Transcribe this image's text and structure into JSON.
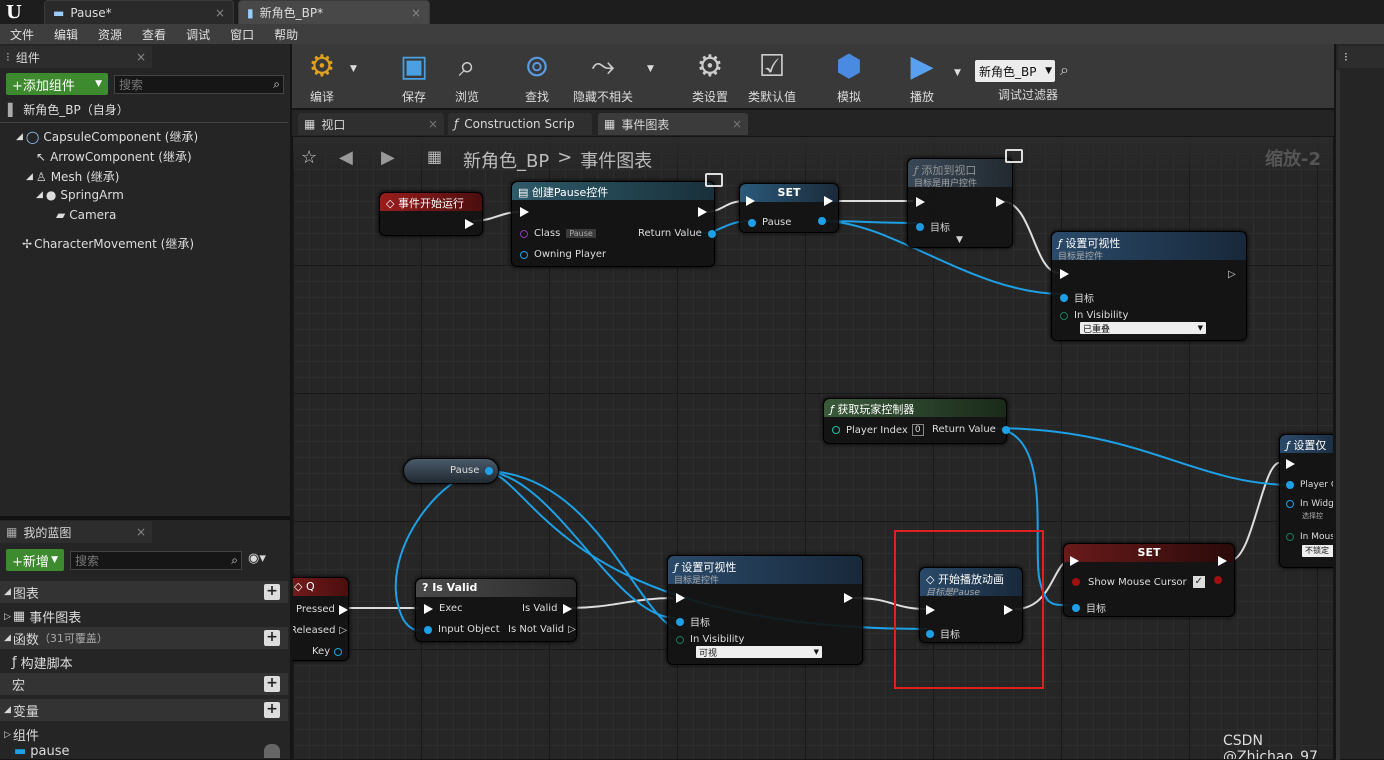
{
  "title_tabs": [
    {
      "label": "Pause*"
    },
    {
      "label": "新角色_BP*"
    }
  ],
  "menu": [
    "文件",
    "编辑",
    "资源",
    "查看",
    "调试",
    "窗口",
    "帮助"
  ],
  "components_panel": {
    "title": "组件",
    "add_button": "+添加组件",
    "search_placeholder": "搜索",
    "self": "新角色_BP（自身）",
    "tree": [
      "CapsuleComponent (继承)",
      "ArrowComponent (继承)",
      "Mesh (继承)",
      "SpringArm",
      "Camera",
      "CharacterMovement (继承)"
    ]
  },
  "blueprint_panel": {
    "title": "我的蓝图",
    "new_button": "+新增",
    "search_placeholder": "搜索",
    "sections": {
      "graphs": "图表",
      "event_graph": "事件图表",
      "functions": "函数",
      "functions_note": "（31可覆盖）",
      "construct": "构建脚本",
      "macros": "宏",
      "variables": "变量",
      "components": "组件",
      "pause": "pause"
    }
  },
  "toolbar": {
    "compile": "编译",
    "save": "保存",
    "browse": "浏览",
    "find": "查找",
    "hide_unrelated": "隐藏不相关",
    "class_settings": "类设置",
    "class_defaults": "类默认值",
    "simulate": "模拟",
    "play": "播放",
    "debug_target": "新角色_BP",
    "debug_filter": "调试过滤器"
  },
  "graph_tabs": [
    "视口",
    "Construction Scrip",
    "事件图表"
  ],
  "breadcrumb": {
    "root": "新角色_BP",
    "sep": ">",
    "current": "事件图表",
    "zoom": "缩放-2"
  },
  "nodes": {
    "begin_play": {
      "title": "事件开始运行"
    },
    "create_widget": {
      "title": "创建Pause控件",
      "class_label": "Class",
      "class_value": "Pause",
      "return_value": "Return Value",
      "owning_player": "Owning Player"
    },
    "set_top": {
      "title": "SET",
      "pin": "Pause"
    },
    "add_to_viewport": {
      "title": "添加到视口",
      "subtitle": "目标是用户控件",
      "target": "目标"
    },
    "set_visibility_top": {
      "title": "设置可视性",
      "subtitle": "目标是控件",
      "target": "目标",
      "in_visibility": "In Visibility",
      "value": "已重叠"
    },
    "get_player_controller": {
      "title": "获取玩家控制器",
      "player_index": "Player Index",
      "index_value": "0",
      "return_value": "Return Value"
    },
    "set_input_mode": {
      "title": "设置仅",
      "player": "Player C",
      "widget": "In Widg",
      "widget_sub": "选择控",
      "mouse": "In Mous",
      "mouse_value": "不锁定"
    },
    "pause_var": {
      "label": "Pause"
    },
    "key_q": {
      "title": "Q",
      "pressed": "Pressed",
      "released": "Released",
      "key": "Key"
    },
    "is_valid": {
      "title": "? Is Valid",
      "exec": "Exec",
      "input": "Input Object",
      "valid": "Is Valid",
      "not_valid": "Is Not Valid"
    },
    "set_visibility_bottom": {
      "title": "设置可视性",
      "subtitle": "目标是控件",
      "target": "目标",
      "in_visibility": "In Visibility",
      "value": "可视"
    },
    "play_animation": {
      "title": "开始播放动画",
      "subtitle": "目标是Pause",
      "target": "目标"
    },
    "set_cursor": {
      "title": "SET",
      "pin": "Show Mouse Cursor",
      "target": "目标"
    }
  },
  "watermark": "CSDN @Zhichao_97",
  "colors": {
    "highlight": "#e02020",
    "wire": "#1ea0e6",
    "exec": "#ffffff"
  }
}
